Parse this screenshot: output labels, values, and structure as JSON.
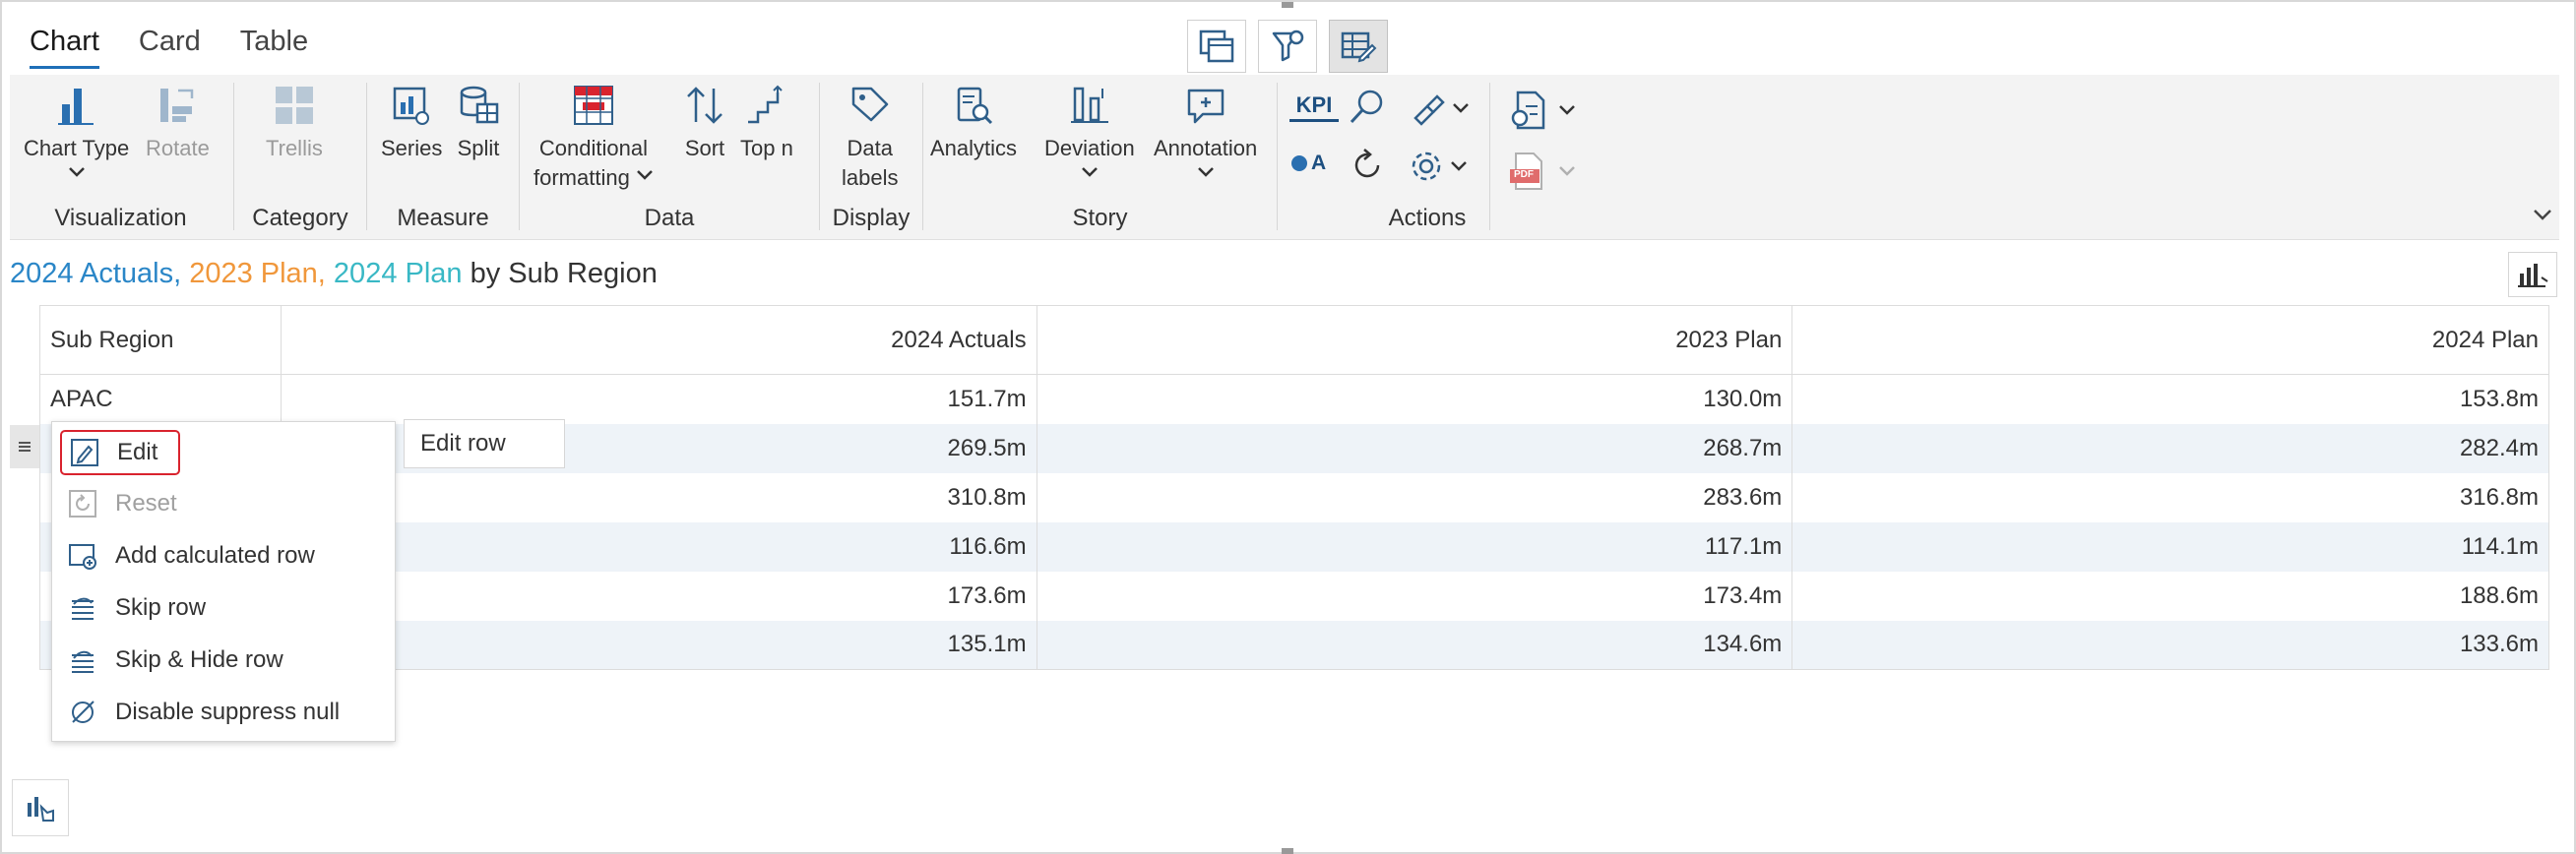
{
  "tabs": [
    {
      "label": "Chart",
      "active": true
    },
    {
      "label": "Card",
      "active": false
    },
    {
      "label": "Table",
      "active": false
    }
  ],
  "view_toggles": [
    {
      "icon": "chart-window-icon",
      "active": false
    },
    {
      "icon": "filter-icon",
      "active": false
    },
    {
      "icon": "table-edit-icon",
      "active": true
    }
  ],
  "ribbon": {
    "visualization": {
      "label": "Visualization",
      "chart_type": "Chart Type",
      "rotate": "Rotate"
    },
    "category": {
      "label": "Category",
      "trellis": "Trellis"
    },
    "measure": {
      "label": "Measure",
      "series": "Series",
      "split": "Split"
    },
    "data": {
      "label": "Data",
      "conditional_line1": "Conditional",
      "conditional_line2": "formatting",
      "sort": "Sort",
      "top_n": "Top n"
    },
    "display": {
      "label": "Display",
      "data_labels_line1": "Data",
      "data_labels_line2": "labels"
    },
    "story": {
      "label": "Story",
      "analytics": "Analytics",
      "deviation": "Deviation",
      "annotation": "Annotation"
    },
    "actions": {
      "label": "Actions",
      "kpi": "KPI",
      "legend_a": "A",
      "pdf": "PDF"
    }
  },
  "chart_title": {
    "part1": "2024 Actuals,",
    "part2": " 2023 Plan,",
    "part3": " 2024 Plan",
    "part4": " by Sub Region"
  },
  "colors": {
    "accent_blue": "#2a86c7",
    "accent_orange": "#f0973b",
    "accent_teal": "#39b8c5",
    "edit_highlight": "#d9232e"
  },
  "table": {
    "headers": [
      "Sub Region",
      "2024 Actuals",
      "2023 Plan",
      "2024 Plan"
    ],
    "rows": [
      {
        "region": "APAC",
        "actuals": "151.7m",
        "plan2023": "130.0m",
        "plan2024": "153.8m"
      },
      {
        "region": "",
        "actuals": "269.5m",
        "plan2023": "268.7m",
        "plan2024": "282.4m"
      },
      {
        "region": "",
        "actuals": "310.8m",
        "plan2023": "283.6m",
        "plan2024": "316.8m"
      },
      {
        "region": "",
        "actuals": "116.6m",
        "plan2023": "117.1m",
        "plan2024": "114.1m"
      },
      {
        "region": "",
        "actuals": "173.6m",
        "plan2023": "173.4m",
        "plan2024": "188.6m"
      },
      {
        "region": "",
        "actuals": "135.1m",
        "plan2023": "134.6m",
        "plan2024": "133.6m"
      }
    ]
  },
  "context_menu": {
    "items": [
      {
        "label": "Edit",
        "icon": "pencil-icon",
        "disabled": false
      },
      {
        "label": "Reset",
        "icon": "reset-icon",
        "disabled": true
      },
      {
        "label": "Add calculated row",
        "icon": "add-calculated-row-icon",
        "disabled": false
      },
      {
        "label": "Skip row",
        "icon": "skip-row-icon",
        "disabled": false
      },
      {
        "label": "Skip & Hide row",
        "icon": "skip-hide-row-icon",
        "disabled": false
      },
      {
        "label": "Disable suppress null",
        "icon": "disable-null-icon",
        "disabled": false
      }
    ]
  },
  "tooltip": {
    "text": "Edit row"
  }
}
